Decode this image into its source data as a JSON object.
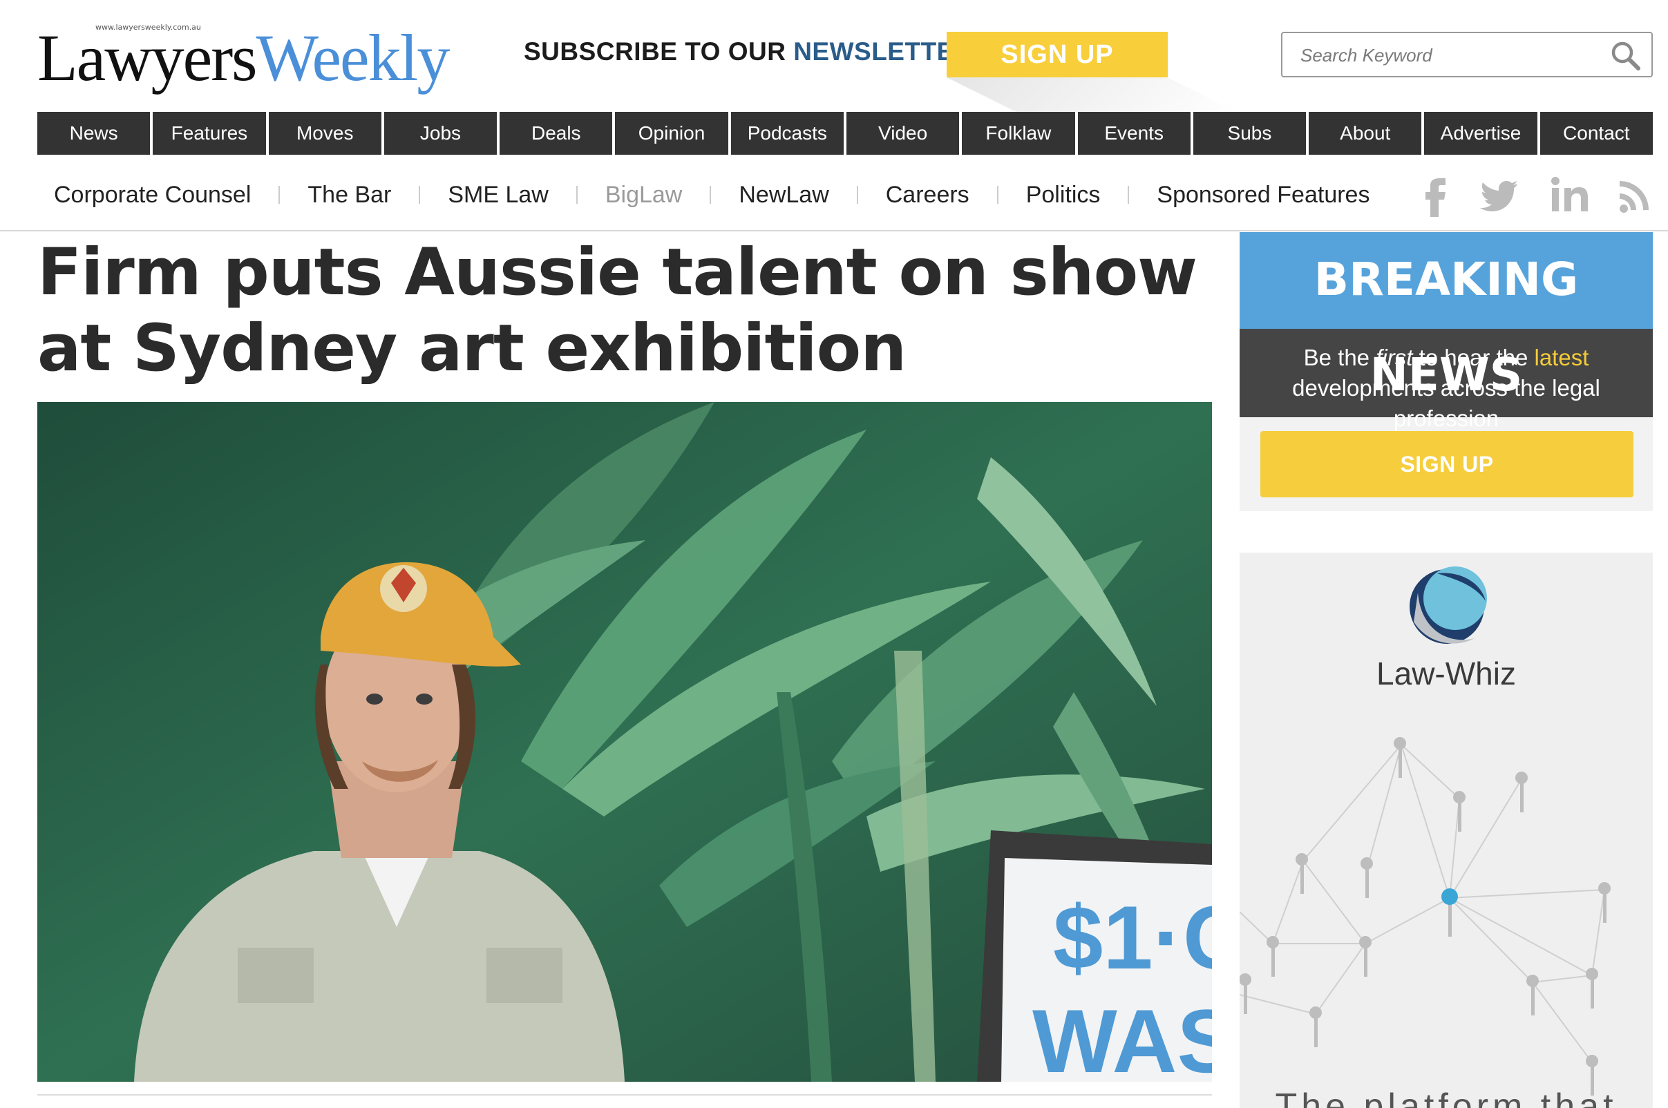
{
  "header": {
    "logo_url": "www.lawyersweekly.com.au",
    "logo_part1": "Lawyers",
    "logo_part2": "Weekly",
    "newsletter_prefix": "SUBSCRIBE TO OUR ",
    "newsletter_highlight": "NEWSLETTER",
    "signup_label": "SIGN UP",
    "search_placeholder": "Search Keyword"
  },
  "nav": {
    "items": [
      "News",
      "Features",
      "Moves",
      "Jobs",
      "Deals",
      "Opinion",
      "Podcasts",
      "Video",
      "Folklaw",
      "Events",
      "Subs",
      "About",
      "Advertise",
      "Contact"
    ]
  },
  "subnav": {
    "items": [
      {
        "label": "Corporate Counsel",
        "muted": false
      },
      {
        "label": "The Bar",
        "muted": false
      },
      {
        "label": "SME Law",
        "muted": false
      },
      {
        "label": "BigLaw",
        "muted": true
      },
      {
        "label": "NewLaw",
        "muted": false
      },
      {
        "label": "Careers",
        "muted": false
      },
      {
        "label": "Politics",
        "muted": false
      },
      {
        "label": "Sponsored Features",
        "muted": false
      }
    ]
  },
  "social": {
    "icons": [
      "facebook-icon",
      "twitter-icon",
      "linkedin-icon",
      "rss-icon"
    ],
    "color": "#bbbbbb"
  },
  "article": {
    "headline": "Firm puts Aussie talent on show at Sydney art exhibition",
    "sign_text_line1": "$1·C",
    "sign_text_line2": "WAS"
  },
  "sidebar": {
    "breaking_title": "BREAKING NEWS",
    "breaking_text_1": "Be the ",
    "breaking_text_first": "first",
    "breaking_text_2": " to hear the ",
    "breaking_text_latest": "latest",
    "breaking_text_3": "developments across the legal profession",
    "signup_label": "SIGN UP",
    "ad_brand": "Law-Whiz",
    "ad_tagline_partial": "The platform that"
  },
  "colors": {
    "accent_blue": "#56a3dc",
    "signup_yellow": "#f8ce3a",
    "nav_dark": "#333333",
    "logo_blue": "#4a8fd8"
  }
}
